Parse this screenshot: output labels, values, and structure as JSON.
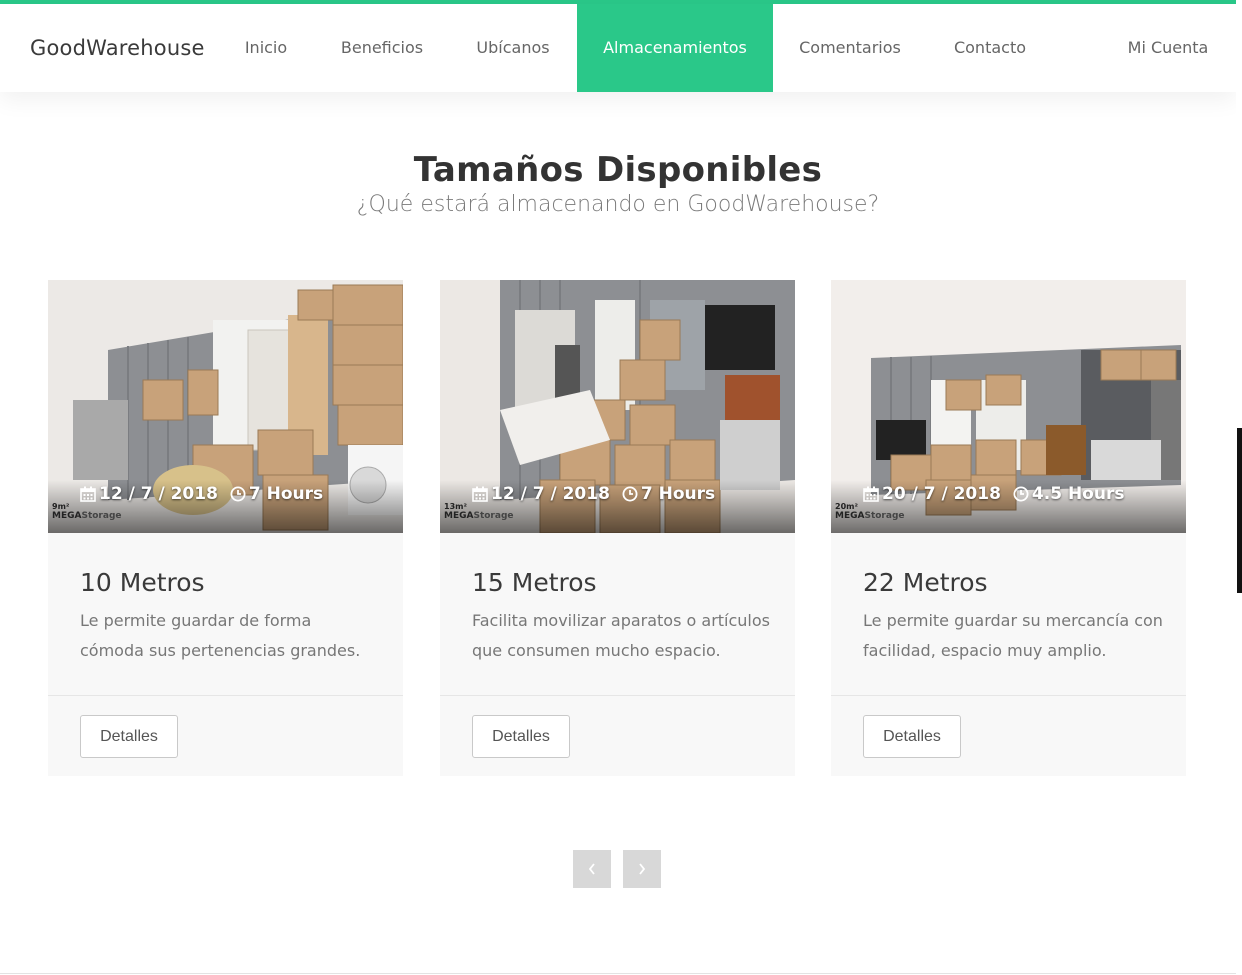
{
  "brand": "GoodWarehouse",
  "nav": {
    "items": [
      "Inicio",
      "Beneficios",
      "Ubícanos",
      "Almacenamientos",
      "Comentarios",
      "Contacto"
    ],
    "active": "Almacenamientos",
    "account": "Mi Cuenta"
  },
  "colors": {
    "accent": "#2ac889",
    "card_bg": "#f8f8f8",
    "pager": "#d8d8d8"
  },
  "section": {
    "title": "Tamaños Disponibles",
    "subtitle": "¿Qué estará almacenando en GoodWarehouse?"
  },
  "cards": [
    {
      "date": "12 / 7 / 2018",
      "duration": "7 Hours",
      "size_tag": "9m²",
      "title": "10 Metros",
      "description": "Le permite guardar de forma cómoda sus pertenencias grandes.",
      "button": "Detalles"
    },
    {
      "date": "12 / 7 / 2018",
      "duration": "7 Hours",
      "size_tag": "13m²",
      "title": "15 Metros",
      "description": "Facilita movilizar aparatos o artículos que consumen mucho espacio.",
      "button": "Detalles"
    },
    {
      "date": "20 / 7 / 2018",
      "duration": "4.5 Hours",
      "size_tag": "20m²",
      "title": "22 Metros",
      "description": "Le permite guardar su mercancía con facilidad, espacio muy amplio.",
      "button": "Detalles"
    }
  ],
  "watermark": {
    "brand": "MEGA",
    "suffix": "Storage"
  },
  "icons": {
    "date": "calendar-icon",
    "duration": "clock-icon",
    "prev": "chevron-left-icon",
    "next": "chevron-right-icon"
  }
}
